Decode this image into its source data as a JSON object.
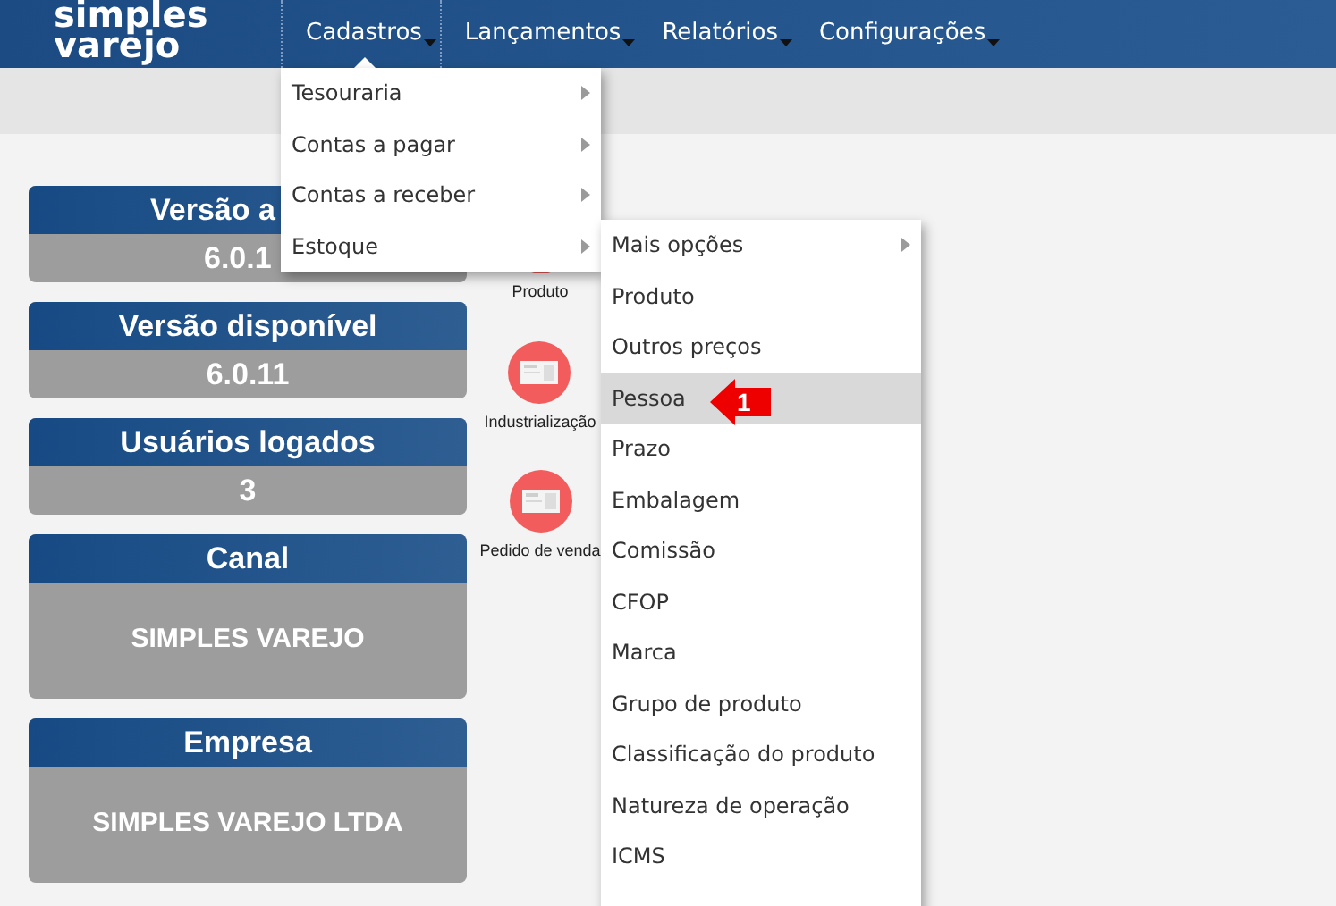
{
  "logo": {
    "line_1": "simples",
    "line_2": "varejo"
  },
  "nav": [
    {
      "label": "Cadastros",
      "selected": true
    },
    {
      "label": "Lançamentos",
      "selected": false
    },
    {
      "label": "Relatórios",
      "selected": false
    },
    {
      "label": "Configurações",
      "selected": false
    }
  ],
  "cards": [
    {
      "title": "Versão a",
      "value": "6.0.1",
      "covered": true,
      "tall": false
    },
    {
      "title": "Versão disponível",
      "value": "6.0.11",
      "covered": false,
      "tall": false
    },
    {
      "title": "Usuários logados",
      "value": "3",
      "covered": false,
      "tall": false
    },
    {
      "title": "Canal",
      "value": "SIMPLES VAREJO",
      "covered": false,
      "tall": true
    },
    {
      "title": "Empresa",
      "value": "SIMPLES VAREJO LTDA",
      "covered": false,
      "tall": true
    }
  ],
  "shortcuts": [
    {
      "label": "Produto"
    },
    {
      "label": "Industrialização"
    },
    {
      "label": "Pedido de venda"
    }
  ],
  "menu": [
    {
      "label": "Tesouraria",
      "has_submenu": true
    },
    {
      "label": "Contas a pagar",
      "has_submenu": true
    },
    {
      "label": "Contas a receber",
      "has_submenu": true
    },
    {
      "label": "Estoque",
      "has_submenu": true
    }
  ],
  "submenu": [
    {
      "label": "Mais opções",
      "has_submenu": true,
      "selected": false
    },
    {
      "label": "Produto",
      "has_submenu": false,
      "selected": false
    },
    {
      "label": "Outros preços",
      "has_submenu": false,
      "selected": false
    },
    {
      "label": "Pessoa",
      "has_submenu": false,
      "selected": true
    },
    {
      "label": "Prazo",
      "has_submenu": false,
      "selected": false
    },
    {
      "label": "Embalagem",
      "has_submenu": false,
      "selected": false
    },
    {
      "label": "Comissão",
      "has_submenu": false,
      "selected": false
    },
    {
      "label": "CFOP",
      "has_submenu": false,
      "selected": false
    },
    {
      "label": "Marca",
      "has_submenu": false,
      "selected": false
    },
    {
      "label": "Grupo de produto",
      "has_submenu": false,
      "selected": false
    },
    {
      "label": "Classificação do produto",
      "has_submenu": false,
      "selected": false
    },
    {
      "label": "Natureza de operação",
      "has_submenu": false,
      "selected": false
    },
    {
      "label": "ICMS",
      "has_submenu": false,
      "selected": false
    }
  ],
  "annotation": {
    "label": "1"
  }
}
